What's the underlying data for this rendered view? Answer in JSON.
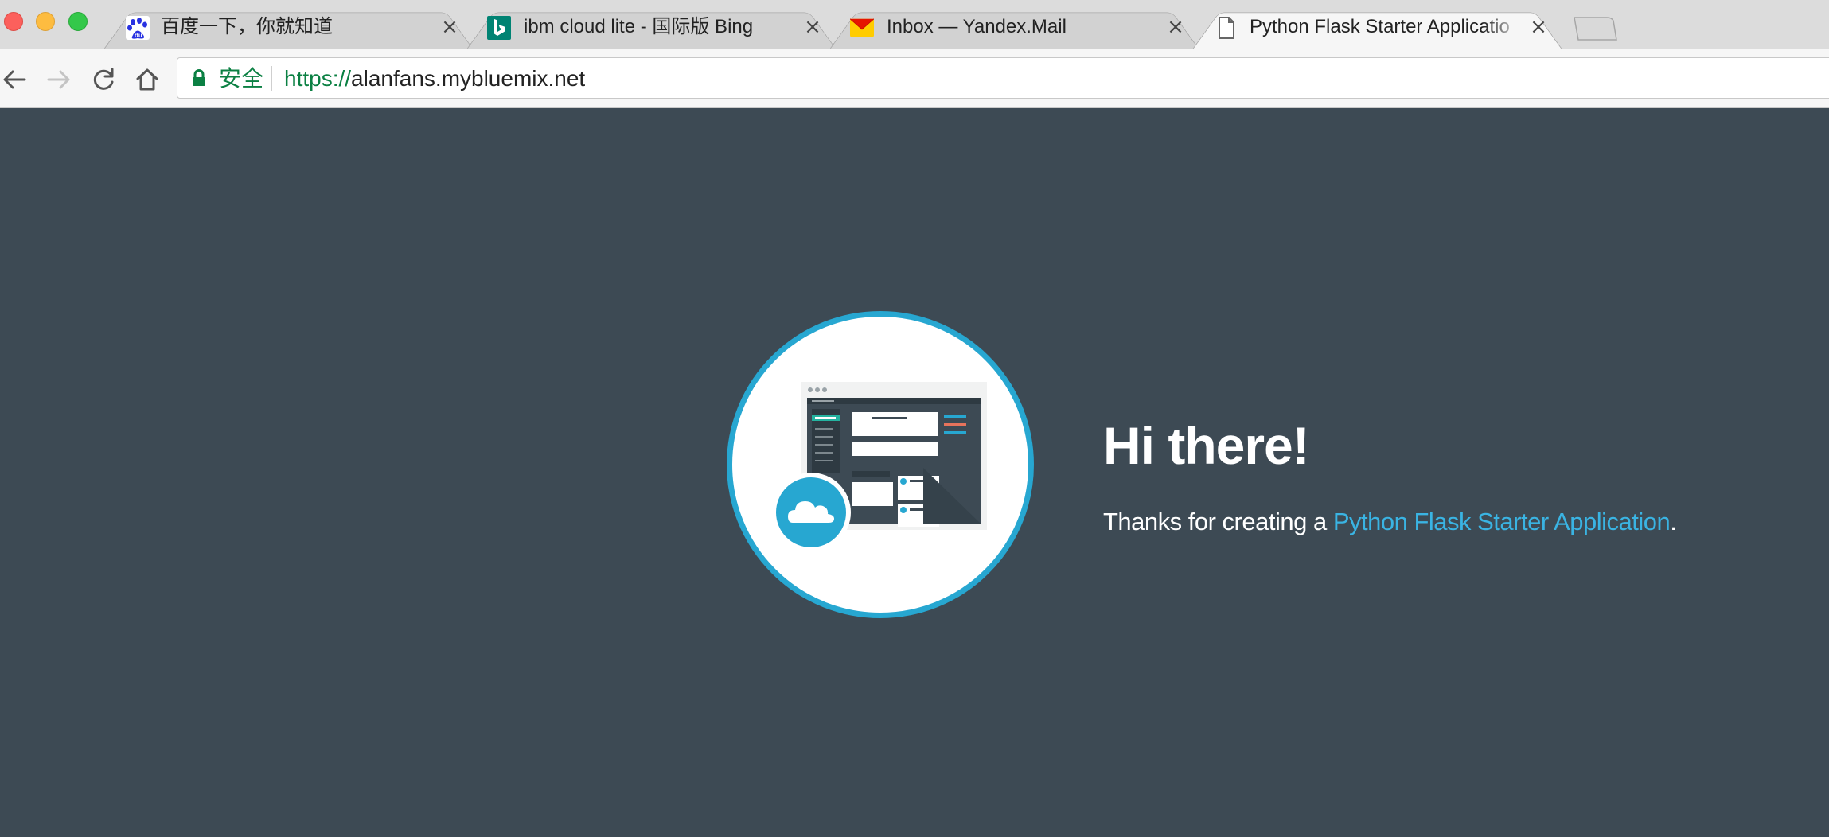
{
  "browser": {
    "tabs": [
      {
        "title": "百度一下，你就知道",
        "icon": "baidu-paw-icon",
        "active": false
      },
      {
        "title": "ibm cloud lite - 国际版 Bing",
        "icon": "bing-icon",
        "active": false
      },
      {
        "title": "Inbox — Yandex.Mail",
        "icon": "yandex-mail-icon",
        "active": false
      },
      {
        "title": "Python Flask Starter Applicatio",
        "icon": "page-icon",
        "active": true
      }
    ],
    "close_glyph": "×",
    "address_bar": {
      "security_label": "安全",
      "url_scheme": "https://",
      "url_host": "alanfans.mybluemix.net"
    }
  },
  "page": {
    "heading": "Hi there!",
    "intro_prefix": "Thanks for creating a ",
    "intro_link": "Python Flask Starter Application",
    "intro_suffix": ".",
    "colors": {
      "background": "#3d4a54",
      "accent": "#27a7d1",
      "link": "#3ab4e3",
      "secure_green": "#0b8043"
    }
  }
}
